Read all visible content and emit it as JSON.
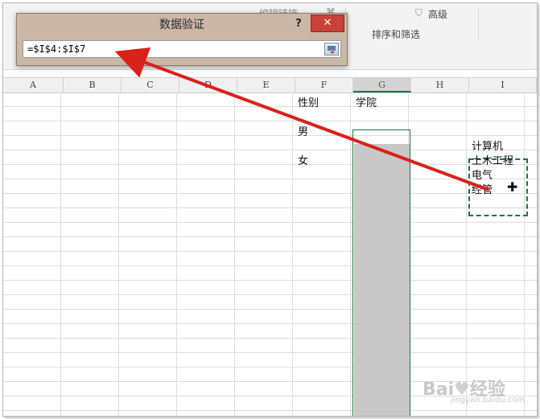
{
  "ribbon": {
    "advanced_label": "高级",
    "sort_filter_label": "排序和筛选",
    "partial_left": "编辑链接"
  },
  "dialog": {
    "title": "数据验证",
    "help": "?",
    "close": "✕",
    "source_value": "=$I$4:$I$7"
  },
  "columns": [
    "A",
    "B",
    "C",
    "D",
    "E",
    "F",
    "G",
    "H",
    "I"
  ],
  "selected_column": "G",
  "cells": {
    "F1": "性别",
    "G1": "学院",
    "F3": "男",
    "F5": "女",
    "I4": "计算机",
    "I5": "土木工程",
    "I6": "电气",
    "I7": "经管"
  },
  "colors": {
    "accent": "#217346",
    "arrow": "#d9211b",
    "dialog_bg": "#cbb7a6"
  },
  "icons": [
    "filter-icon",
    "collapse-dialog-icon",
    "move-cursor-icon",
    "close-icon",
    "help-icon"
  ]
}
